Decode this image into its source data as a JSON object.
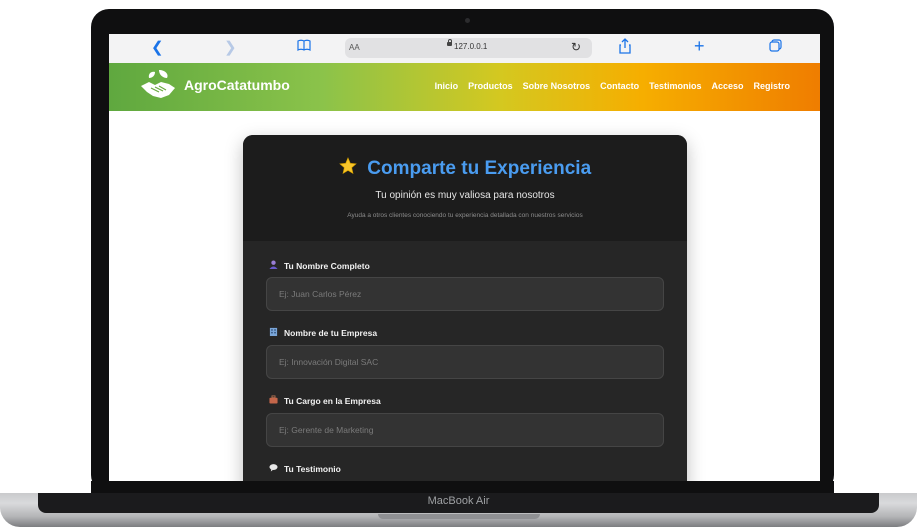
{
  "device": {
    "label": "MacBook Air"
  },
  "browser": {
    "aa_label": "AA",
    "url": "127.0.0.1",
    "icons": [
      "chevron-left-icon",
      "chevron-right-icon",
      "book-icon",
      "lock-icon",
      "reload-icon",
      "share-icon",
      "plus-icon",
      "tabs-icon"
    ]
  },
  "header": {
    "brand": "AgroCatatumbo",
    "nav": [
      "Inicio",
      "Productos",
      "Sobre Nosotros",
      "Contacto",
      "Testimonios",
      "Acceso",
      "Registro"
    ]
  },
  "form": {
    "title": "Comparte tu Experiencia",
    "subtitle": "Tu opinión es muy valiosa para nosotros",
    "description": "Ayuda a otros clientes conociendo tu experiencia detallada con nuestros servicios",
    "fields": [
      {
        "label": "Tu Nombre Completo",
        "icon": "person-icon",
        "placeholder": "Ej: Juan Carlos Pérez",
        "value": ""
      },
      {
        "label": "Nombre de tu Empresa",
        "icon": "building-icon",
        "placeholder": "Ej: Innovación Digital SAC",
        "value": ""
      },
      {
        "label": "Tu Cargo en la Empresa",
        "icon": "briefcase-icon",
        "placeholder": "Ej: Gerente de Marketing",
        "value": ""
      },
      {
        "label": "Tu Testimonio",
        "icon": "speech-bubble-icon"
      }
    ]
  },
  "colors": {
    "accent": "#4a9cf0",
    "card_bg": "#262626",
    "header_gradient": [
      "#5fa83f",
      "#8bc34a",
      "#f6ae00",
      "#ef7d00"
    ]
  }
}
